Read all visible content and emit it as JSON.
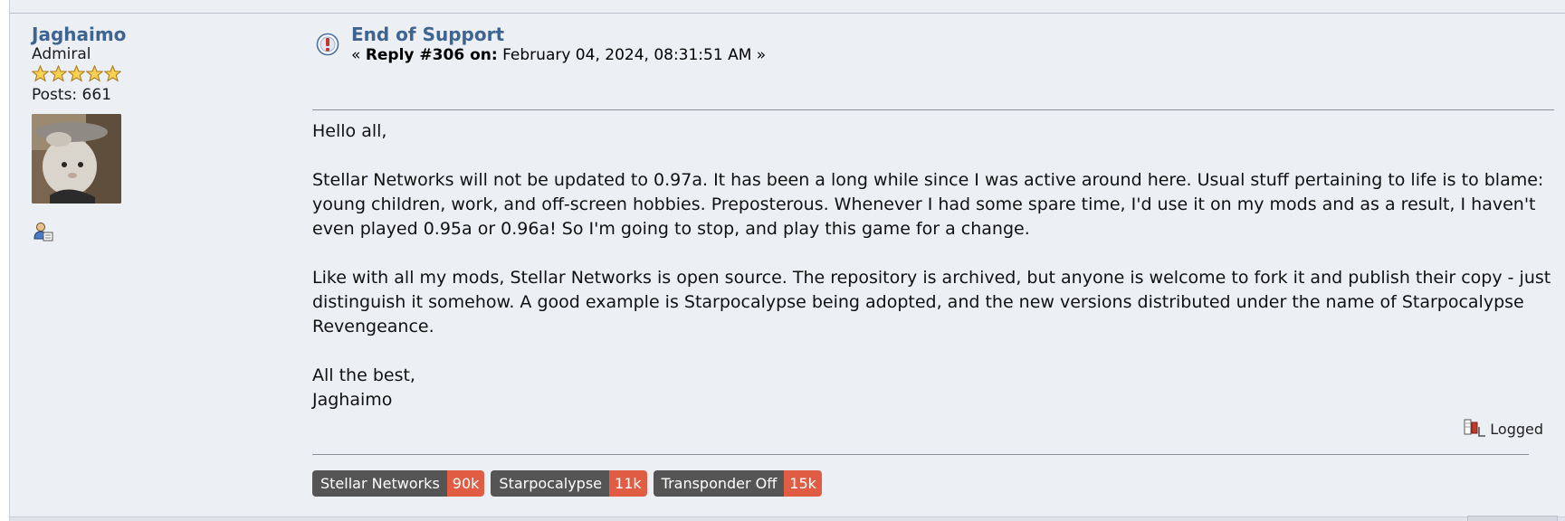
{
  "poster": {
    "name": "Jaghaimo",
    "rank": "Admiral",
    "stars": 5,
    "posts_label": "Posts: 661"
  },
  "post": {
    "subject": "End of Support",
    "reply_prefix": "« ",
    "reply_label": "Reply #306 on:",
    "reply_date": " February 04, 2024, 08:31:51 AM »",
    "paragraphs": [
      "Hello all,",
      "Stellar Networks will not be updated to 0.97a. It has been a long while since I was active around here. Usual stuff pertaining to life is to blame: young children, work, and off-screen hobbies. Preposterous. Whenever I had some spare time, I'd use it on my mods and as a result, I haven't even played 0.95a or 0.96a! So I'm going to stop, and play this game for a change.",
      "Like with all my mods, Stellar Networks is open source. The repository is archived, but anyone is welcome to fork it and publish their copy - just distinguish it somehow. A good example is Starpocalypse being adopted, and the new versions distributed under the name of Starpocalypse Revengeance."
    ],
    "signoff_line1": "All the best,",
    "signoff_line2": "Jaghaimo",
    "logged_label": "Logged"
  },
  "signature": {
    "badges": [
      {
        "label": "Stellar Networks",
        "count": "90k"
      },
      {
        "label": "Starpocalypse",
        "count": "11k"
      },
      {
        "label": "Transponder Off",
        "count": "15k"
      }
    ]
  },
  "colors": {
    "background": "#eceff4",
    "link": "#3e6592",
    "badge_label": "#555555",
    "badge_count": "#e05d44"
  }
}
